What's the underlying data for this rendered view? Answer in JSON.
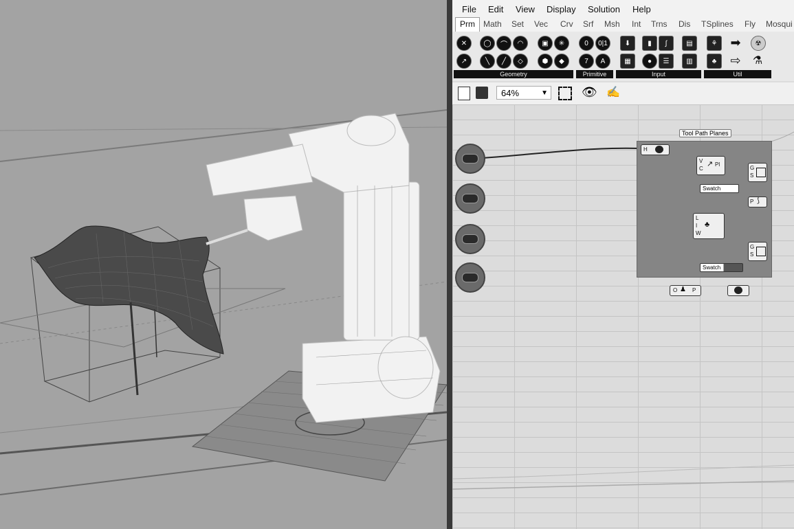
{
  "menubar": {
    "items": [
      "File",
      "Edit",
      "View",
      "Display",
      "Solution",
      "Help"
    ]
  },
  "tabs": [
    "Prm",
    "Math",
    "Set",
    "Vec",
    "Crv",
    "Srf",
    "Msh",
    "Int",
    "Trns",
    "Dis",
    "TSplines",
    "Fly",
    "Mosqui"
  ],
  "active_tab": "Prm",
  "ribbon_groups": [
    "Geometry",
    "Primitive",
    "Input",
    "Util"
  ],
  "zoom_level": "64%",
  "group_label": "Tool Path Planes",
  "components": {
    "input_h": "H",
    "vc_pl": "Pl",
    "v": "V",
    "c": "C",
    "swatch1": "Swatch",
    "swatch2": "Swatch",
    "g1": "G",
    "s1": "S",
    "p": "P",
    "l": "L",
    "i": "I",
    "w": "W",
    "g2": "G",
    "s2": "S",
    "o": "O",
    "p2": "P"
  }
}
